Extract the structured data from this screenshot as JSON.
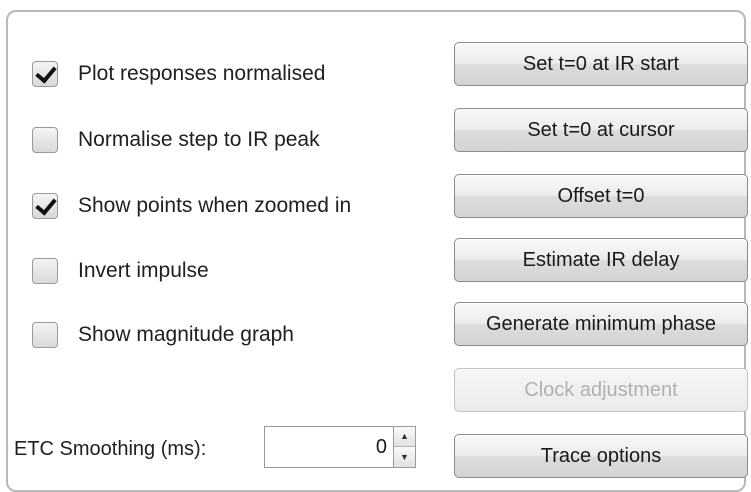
{
  "options": {
    "checkboxes": [
      {
        "label": "Plot responses normalised",
        "checked": true
      },
      {
        "label": "Normalise step to IR peak",
        "checked": false
      },
      {
        "label": "Show points when zoomed in",
        "checked": true
      },
      {
        "label": "Invert impulse",
        "checked": false
      },
      {
        "label": "Show magnitude graph",
        "checked": false
      }
    ]
  },
  "actions": {
    "buttons": [
      {
        "label": "Set t=0 at IR start",
        "enabled": true
      },
      {
        "label": "Set t=0 at cursor",
        "enabled": true
      },
      {
        "label": "Offset t=0",
        "enabled": true
      },
      {
        "label": "Estimate IR delay",
        "enabled": true
      },
      {
        "label": "Generate minimum phase",
        "enabled": true
      },
      {
        "label": "Clock adjustment",
        "enabled": false
      },
      {
        "label": "Trace options",
        "enabled": true
      }
    ]
  },
  "smoothing": {
    "label": "ETC Smoothing (ms):",
    "value": "0",
    "spinner_up_icon": "triangle-up-icon",
    "spinner_down_icon": "triangle-down-icon"
  }
}
